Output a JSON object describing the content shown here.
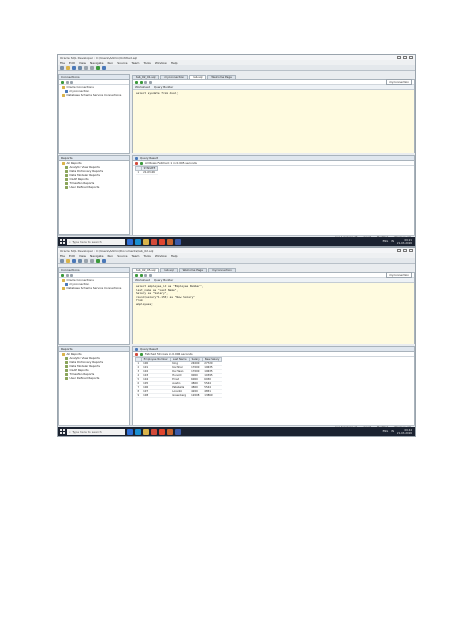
{
  "screens": [
    {
      "window_title": "Oracle SQL Developer : C:\\Users\\Admin\\Untitled.sql",
      "menus": [
        "File",
        "Edit",
        "View",
        "Navigate",
        "Run",
        "Source",
        "Team",
        "Tools",
        "Window",
        "Help"
      ],
      "connections_title": "Connections",
      "connections": [
        "Oracle Connections",
        "myconnection",
        "Database Schema Service Connections"
      ],
      "doc_tabs": [
        "tab_02_01.sql",
        "myconnection",
        "lab.sql",
        "Welcome Page"
      ],
      "worksheet_tabs": [
        "Worksheet",
        "Query Builder"
      ],
      "connection_selector": "myconnection",
      "code": [
        "select sysdate from dual;"
      ],
      "reports_title": "Reports",
      "reports": [
        "All Reports",
        "Analytic View Reports",
        "Data Dictionary Reports",
        "Data Modeler Reports",
        "OLAP Reports",
        "TimesTen Reports",
        "User Defined Reports"
      ],
      "result_tab": "Query Result",
      "result_status": "All Rows Fetched: 1 in 0.005 seconds",
      "columns": [
        "SYSDATE"
      ],
      "rows": [
        [
          "1",
          "21-03-06"
        ]
      ],
      "status_items": [
        "Line 1 Column 26",
        "Insert",
        "Modified",
        "Windows: CR"
      ],
      "taskbar_search": "Type here to search",
      "tray_lang": "ENG",
      "tray_region": "IN",
      "clock_time": "09:21",
      "clock_date": "21-03-2026"
    },
    {
      "window_title": "Oracle SQL Developer : C:\\Users\\Admin\\Documents\\lab_02.sql",
      "menus": [
        "File",
        "Edit",
        "View",
        "Navigate",
        "Run",
        "Source",
        "Team",
        "Tools",
        "Window",
        "Help"
      ],
      "connections_title": "Connections",
      "connections": [
        "Oracle Connections",
        "myconnection",
        "Database Schema Service Connections"
      ],
      "doc_tabs": [
        "tab_02_05.sql",
        "lab.sql",
        "Welcome Page",
        "myconnection"
      ],
      "worksheet_tabs": [
        "Worksheet",
        "Query Builder"
      ],
      "connection_selector": "myconnection",
      "code": [
        "select employee_id as \"Employee Number\",",
        "last_name as \"Last Name\",",
        "Salary as \"Salary\",",
        "round(salary*1.155) as \"New Salary\"",
        "from",
        "employees;"
      ],
      "reports_title": "Reports",
      "reports": [
        "All Reports",
        "Analytic View Reports",
        "Data Dictionary Reports",
        "Data Modeler Reports",
        "OLAP Reports",
        "TimesTen Reports",
        "User Defined Reports"
      ],
      "result_tab": "Query Result",
      "result_status": "Fetched 50 rows in 0.006 seconds",
      "columns": [
        "Employee Number",
        "Last Name",
        "Salary",
        "New Salary"
      ],
      "rows": [
        [
          "1",
          "100",
          "King",
          "24000",
          "27720"
        ],
        [
          "2",
          "101",
          "Kochhar",
          "17000",
          "19635"
        ],
        [
          "3",
          "102",
          "De Haan",
          "17000",
          "19635"
        ],
        [
          "4",
          "103",
          "Hunold",
          "9000",
          "10395"
        ],
        [
          "5",
          "104",
          "Ernst",
          "6000",
          "6930"
        ],
        [
          "6",
          "105",
          "Austin",
          "4800",
          "5544"
        ],
        [
          "7",
          "106",
          "Pataballa",
          "4800",
          "5544"
        ],
        [
          "8",
          "107",
          "Lorentz",
          "4200",
          "4851"
        ],
        [
          "9",
          "108",
          "Greenberg",
          "12008",
          "13869"
        ]
      ],
      "status_items": [
        "Line 6 Column 11",
        "Insert",
        "Modified",
        "Windows: CR"
      ],
      "taskbar_search": "Type here to search",
      "tray_lang": "ENG",
      "tray_region": "IN",
      "clock_time": "09:44",
      "clock_date": "21-03-2026"
    }
  ],
  "colors": {
    "taskbar": "#1b2230",
    "keyword": "#1f3fa8",
    "string": "#b23a2e",
    "run_green": "#3c9a3c"
  },
  "icons": [
    "windows-logo-icon",
    "search-icon",
    "run-icon",
    "database-icon",
    "folder-icon",
    "report-icon"
  ]
}
